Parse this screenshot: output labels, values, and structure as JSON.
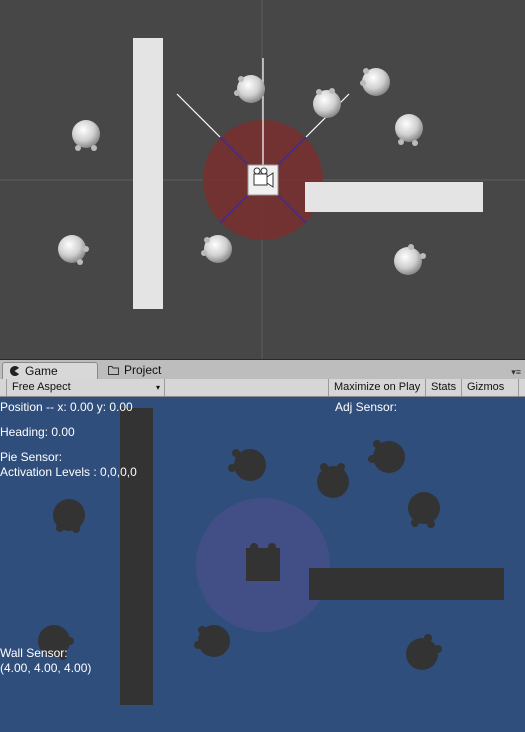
{
  "tabs": {
    "game_label": "Game",
    "project_label": "Project",
    "menu_glyph": "▾≡"
  },
  "toolbar": {
    "aspect": "Free Aspect",
    "maximize": "Maximize on Play",
    "stats": "Stats",
    "gizmos": "Gizmos",
    "arrow": "▾"
  },
  "hud": {
    "position": "Position -- x: 0.00    y: 0.00",
    "adj_sensor": "Adj Sensor:",
    "heading": "Heading: 0.00",
    "pie_sensor": "Pie Sensor:",
    "activation": "Activation Levels : 0,0,0,0",
    "wall_sensor": "Wall Sensor:",
    "wall_values": "(4.00, 4.00, 4.00)"
  },
  "colors": {
    "scene_bg": "#474747",
    "game_bg": "#2f4e7c",
    "sensor_circle_scene": "#7a2f2f",
    "sensor_lines": "#3a2a9a",
    "wall_scene": "#e4e4e4",
    "wall_game": "#333333"
  },
  "icons": {
    "game_tab": "pacman-icon",
    "project_tab": "folder-icon",
    "camera": "camera-gizmo-icon"
  }
}
